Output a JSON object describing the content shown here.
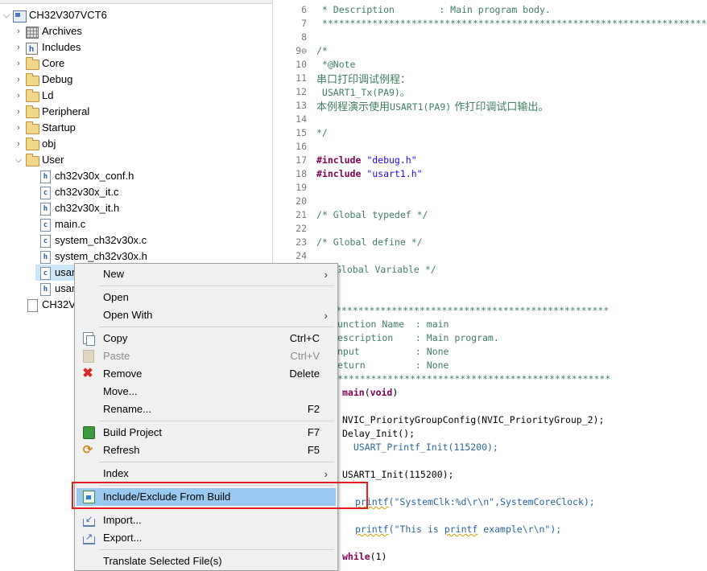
{
  "tree": {
    "project": "CH32V307VCT6",
    "folders": [
      "Archives",
      "Includes",
      "Core",
      "Debug",
      "Ld",
      "Peripheral",
      "Startup",
      "obj",
      "User"
    ],
    "user_files": [
      {
        "name": "ch32v30x_conf.h",
        "ext": "h"
      },
      {
        "name": "ch32v30x_it.c",
        "ext": "c"
      },
      {
        "name": "ch32v30x_it.h",
        "ext": "h"
      },
      {
        "name": "main.c",
        "ext": "c"
      },
      {
        "name": "system_ch32v30x.c",
        "ext": "c"
      },
      {
        "name": "system_ch32v30x.h",
        "ext": "h"
      },
      {
        "name": "usar",
        "ext": "c"
      },
      {
        "name": "usar",
        "ext": "h"
      }
    ],
    "root_file": "CH32V"
  },
  "editor": {
    "line_numbers": [
      "6",
      "7",
      "8",
      "9⊖",
      "10",
      "11",
      "12",
      "13",
      "14",
      "15",
      "16",
      "17",
      "18",
      "19",
      "20",
      "21",
      "22",
      "23",
      "24"
    ],
    "lines": {
      "l6": " * Description        : Main program body.",
      "l7": " *********************************************************************************",
      "l8": "",
      "l9": "/*",
      "l10": " *@Note",
      "l11": "串口打印调试例程：",
      "l12": " USART1_Tx(PA9)。",
      "l13a": "本例程演示使用",
      "l13b": "USART1(PA9)",
      "l13c": " 作打印调试口输出。",
      "l15": "*/",
      "l17_kw": "#include",
      "l17_str": " \"debug.h\"",
      "l18_kw": "#include",
      "l18_str": " \"usart1.h\"",
      "l21": "/* Global typedef */",
      "l23": "/* Global define */",
      "l25": "Global Variable */",
      "stars_a": "*************************************************",
      "fn_name": "unction Name  : main",
      "fn_desc": "escription    : Main program.",
      "fn_in": "nput          : None",
      "fn_ret": "eturn         : None",
      "stars_b": "*************************************************",
      "main_kw": "main",
      "main_arg_kw": "void",
      "nvic": "NVIC_PriorityGroupConfig(NVIC_PriorityGroup_2);",
      "delay": "Delay_Init();",
      "uprint": "  USART_Printf_Init(115200);",
      "usart1": "USART1_Init(115200);",
      "printf1_fn": "printf",
      "printf1_rest": "(\"SystemClk:%d\\r\\n\",SystemCoreClock);",
      "printf2_fn": "printf",
      "printf2_a": "(\"This is ",
      "printf2_b": "printf",
      "printf2_c": " example\\r\\n\");",
      "while_kw": "while",
      "while_rest": "(1)"
    }
  },
  "menu": {
    "new": "New",
    "open": "Open",
    "open_with": "Open With",
    "copy": "Copy",
    "copy_sc": "Ctrl+C",
    "paste": "Paste",
    "paste_sc": "Ctrl+V",
    "remove": "Remove",
    "remove_sc": "Delete",
    "move": "Move...",
    "rename": "Rename...",
    "rename_sc": "F2",
    "build": "Build Project",
    "build_sc": "F7",
    "refresh": "Refresh",
    "refresh_sc": "F5",
    "index": "Index",
    "include_exclude": "Include/Exclude From Build",
    "import": "Import...",
    "export": "Export...",
    "translate": "Translate Selected File(s)",
    "submenu_glyph": "›"
  },
  "colors": {
    "highlight": "#99c9f0",
    "annotation_box": "#e02020",
    "comment": "#3f7f5f",
    "keyword": "#7f0055",
    "string": "#2a00ff"
  }
}
